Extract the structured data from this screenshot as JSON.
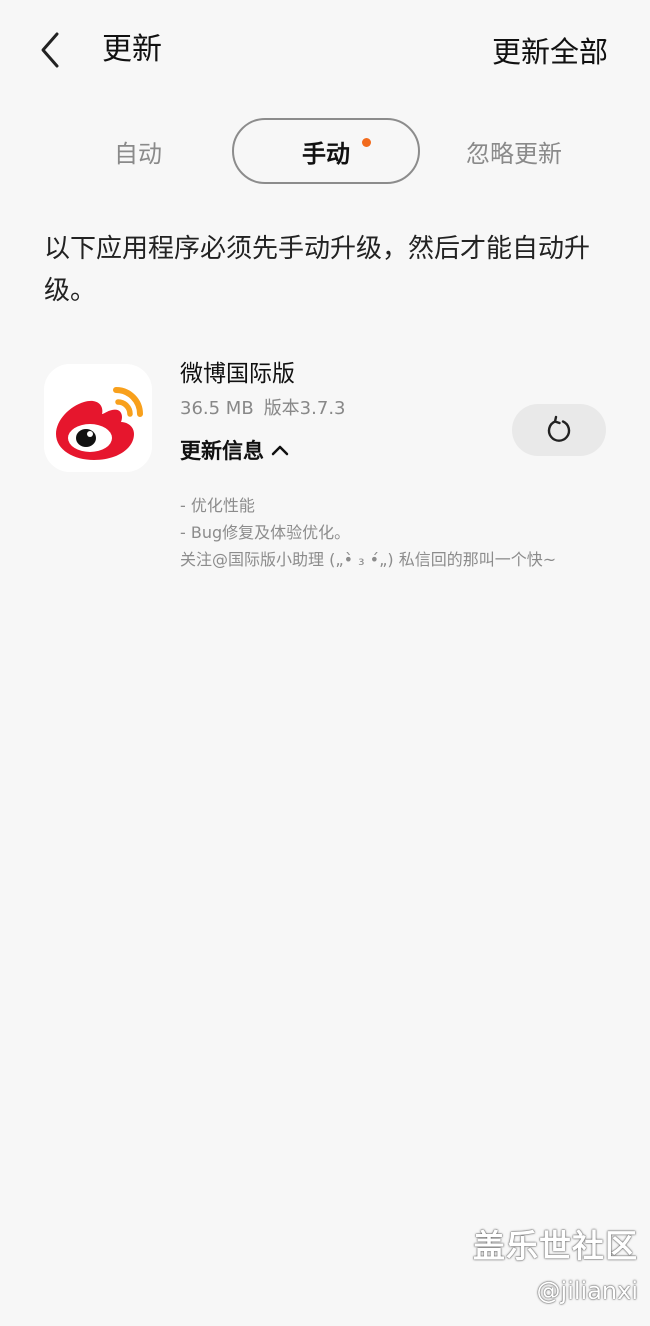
{
  "header": {
    "title": "更新",
    "update_all_label": "更新全部"
  },
  "tabs": [
    {
      "label": "自动"
    },
    {
      "label": "手动",
      "active": true,
      "has_dot": true
    },
    {
      "label": "忽略更新"
    }
  ],
  "notice_text": "以下应用程序必须先手动升级，然后才能自动升级。",
  "app": {
    "name": "微博国际版",
    "size": "36.5 MB",
    "version": "版本3.7.3",
    "info_toggle_label": "更新信息",
    "changelog": [
      "- 优化性能",
      "- Bug修复及体验优化。",
      "关注@国际版小助理 („•̀ ₃ •́„) 私信回的那叫一个快~"
    ]
  },
  "watermark": {
    "title": "盖乐世社区",
    "handle": "@jilianxi"
  },
  "colors": {
    "background": "#f7f7f7",
    "tab_dot": "#f26b1d",
    "weibo_red": "#e6162d",
    "weibo_orange": "#f8a01c"
  },
  "icons": {
    "back": "chevron-left-icon",
    "expand": "chevron-up-icon",
    "update": "refresh-icon",
    "app": "weibo-logo-icon"
  }
}
